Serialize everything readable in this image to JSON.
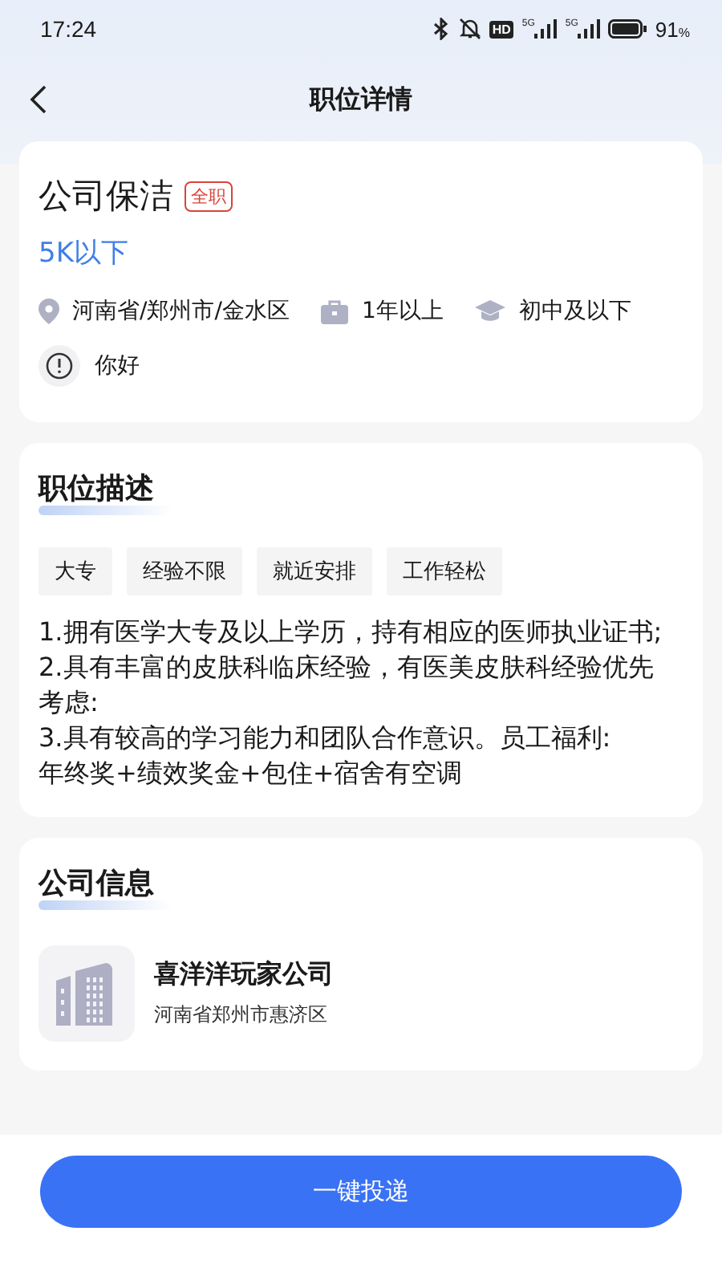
{
  "status_bar": {
    "time": "17:24",
    "hd": "HD",
    "networks": [
      "5G",
      "5G"
    ],
    "battery": "91",
    "battery_unit": "%"
  },
  "nav": {
    "title": "职位详情"
  },
  "job": {
    "title": "公司保洁",
    "type_tag": "全职",
    "salary": "5K以下",
    "meta": [
      {
        "kind": "location",
        "text": "河南省/郑州市/金水区"
      },
      {
        "kind": "experience",
        "text": "1年以上"
      },
      {
        "kind": "education",
        "text": "初中及以下"
      }
    ],
    "note": "你好"
  },
  "description": {
    "heading": "职位描述",
    "tags": [
      "大专",
      "经验不限",
      "就近安排",
      "工作轻松"
    ],
    "text": "1.拥有医学大专及以上学历，持有相应的医师执业证书;\n2.具有丰富的皮肤科临床经验，有医美皮肤科经验优先考虑:\n3.具有较高的学习能力和团队合作意识。员工福利:\n年终奖+绩效奖金+包住+宿舍有空调"
  },
  "company": {
    "heading": "公司信息",
    "name": "喜洋洋玩家公司",
    "address": "河南省郑州市惠济区"
  },
  "apply_button": "一键投递"
}
